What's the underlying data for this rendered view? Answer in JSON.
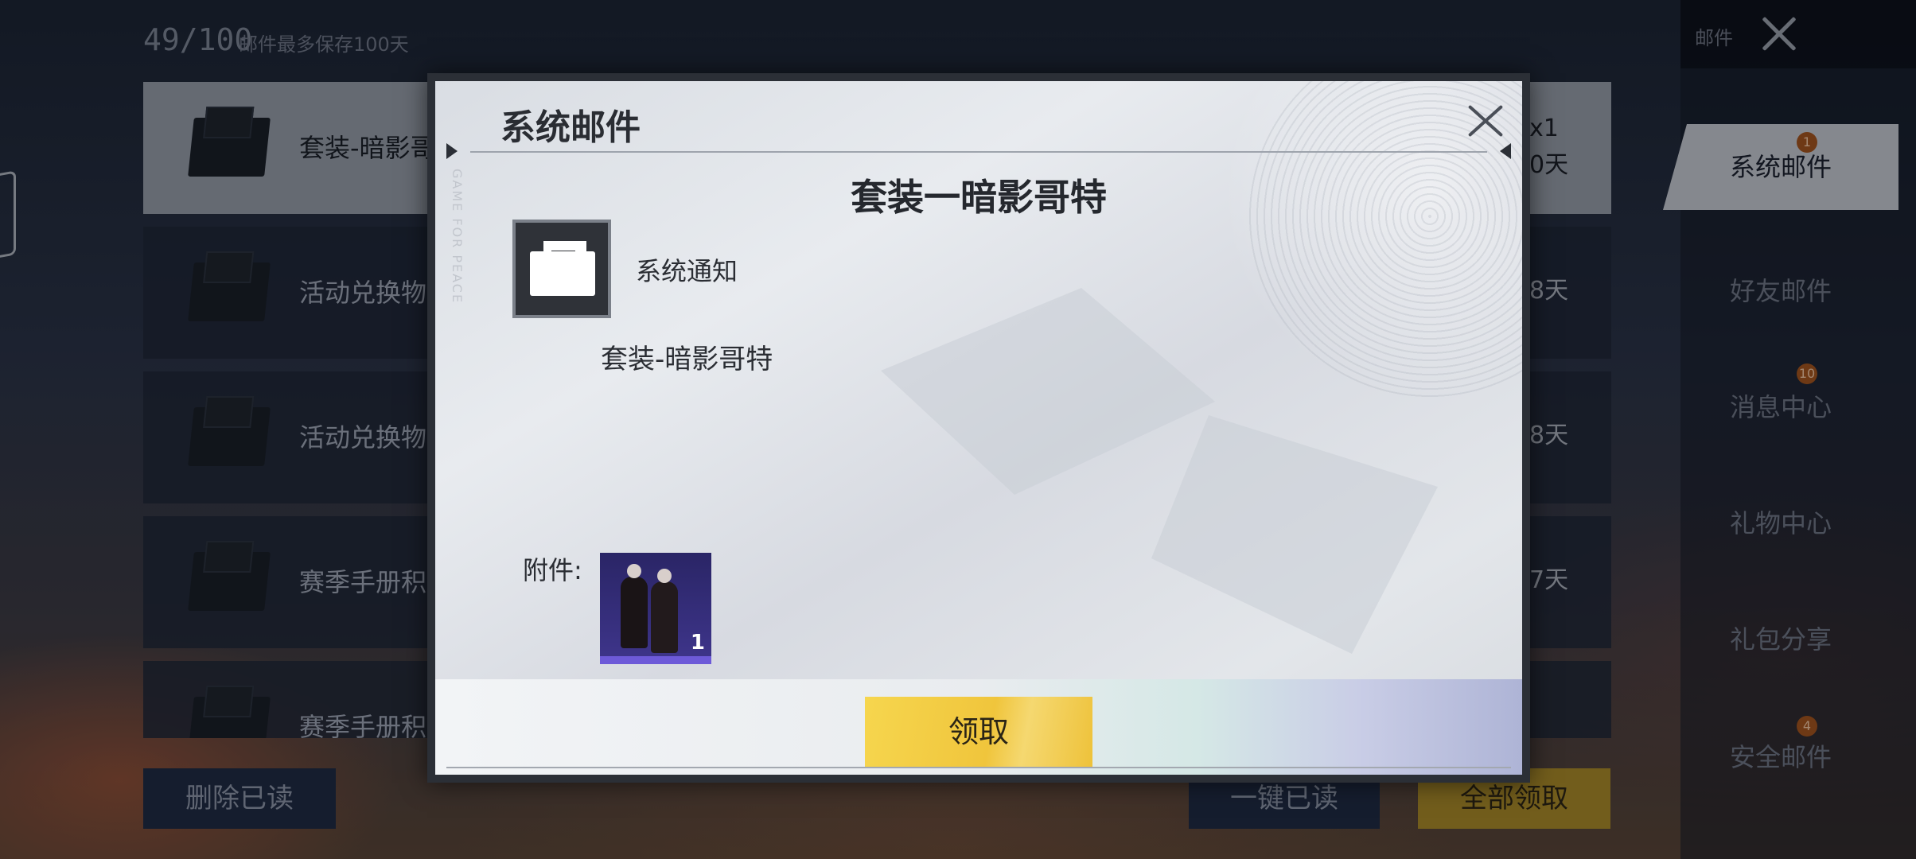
{
  "header": {
    "mail_count": "49/100",
    "mail_note": "邮件最多保存100天",
    "panel_title": "邮件"
  },
  "mail_list": [
    {
      "subject": "套装-暗影哥",
      "right_top": "x1",
      "right_bottom": "0天"
    },
    {
      "subject": "活动兑换物",
      "right_top": "",
      "right_bottom": "8天"
    },
    {
      "subject": "活动兑换物",
      "right_top": "",
      "right_bottom": "8天"
    },
    {
      "subject": "赛季手册积",
      "right_top": "",
      "right_bottom": "7天"
    },
    {
      "subject": "赛季手册积",
      "right_top": "",
      "right_bottom": ""
    }
  ],
  "bottom_buttons": {
    "delete_read": "删除已读",
    "mark_all_read": "一键已读",
    "claim_all": "全部领取"
  },
  "tabs": [
    {
      "label": "系统邮件",
      "badge": "1",
      "active": true
    },
    {
      "label": "好友邮件",
      "badge": "",
      "active": false
    },
    {
      "label": "消息中心",
      "badge": "10",
      "active": false
    },
    {
      "label": "礼物中心",
      "badge": "",
      "active": false
    },
    {
      "label": "礼包分享",
      "badge": "",
      "active": false
    },
    {
      "label": "安全邮件",
      "badge": "4",
      "active": false
    }
  ],
  "modal": {
    "title": "系统邮件",
    "vertical_text": "GAME FOR PEACE",
    "heading": "套装一暗影哥特",
    "sender": "系统通知",
    "body": "套装-暗影哥特",
    "attach_label": "附件:",
    "attachment_count": "1",
    "claim_button": "领取"
  },
  "colors": {
    "claim_yellow": "#f0c53c",
    "active_tab": "#c5c9d1",
    "badge_orange": "#a3541f",
    "attachment_purple": "#3d3489"
  }
}
